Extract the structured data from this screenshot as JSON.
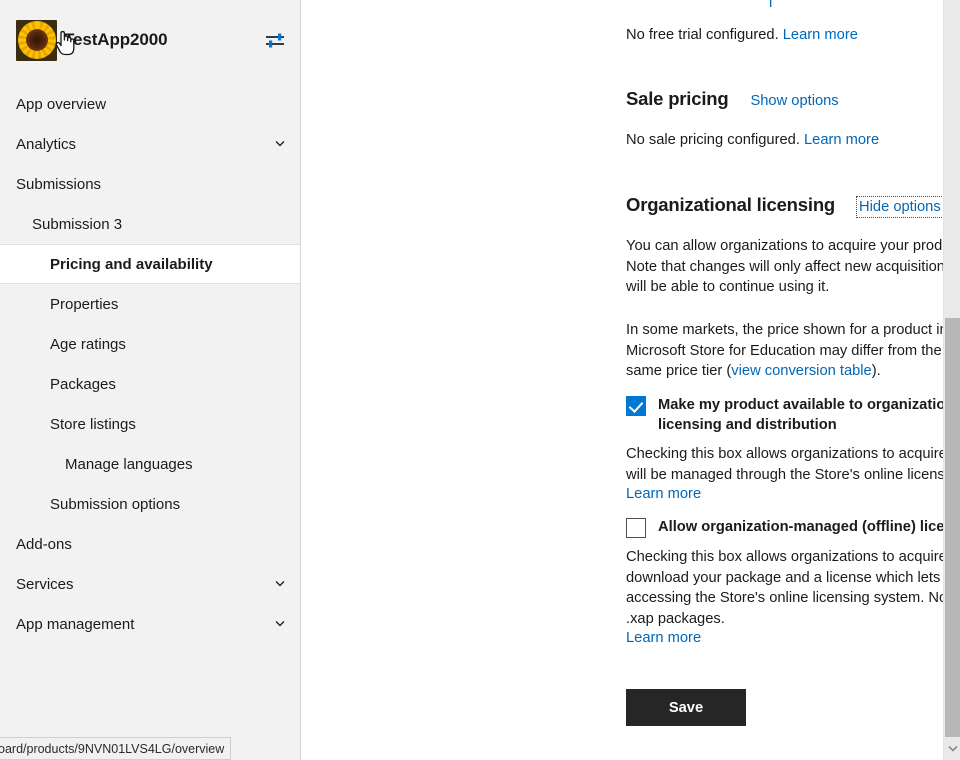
{
  "sidebar": {
    "brand": {
      "name": "TestApp2000",
      "logo_icon": "sunflower-app-icon",
      "toggle_icon": "sliders-settings-icon"
    },
    "items": [
      {
        "label": "App overview",
        "level": 0,
        "selected": false,
        "chevron": false
      },
      {
        "label": "Analytics",
        "level": 0,
        "selected": false,
        "chevron": true
      },
      {
        "label": "Submissions",
        "level": 0,
        "selected": false,
        "chevron": false
      },
      {
        "label": "Submission 3",
        "level": 1,
        "selected": false,
        "chevron": false
      },
      {
        "label": "Pricing and availability",
        "level": 2,
        "selected": true,
        "chevron": false
      },
      {
        "label": "Properties",
        "level": 2,
        "selected": false,
        "chevron": false
      },
      {
        "label": "Age ratings",
        "level": 2,
        "selected": false,
        "chevron": false
      },
      {
        "label": "Packages",
        "level": 2,
        "selected": false,
        "chevron": false
      },
      {
        "label": "Store listings",
        "level": 2,
        "selected": false,
        "chevron": false
      },
      {
        "label": "Manage languages",
        "level": 3,
        "selected": false,
        "chevron": false
      },
      {
        "label": "Submission options",
        "level": 2,
        "selected": false,
        "chevron": false
      },
      {
        "label": "Add-ons",
        "level": 0,
        "selected": false,
        "chevron": false
      },
      {
        "label": "Services",
        "level": 0,
        "selected": false,
        "chevron": true
      },
      {
        "label": "App management",
        "level": 0,
        "selected": false,
        "chevron": true
      }
    ]
  },
  "status_bar": {
    "url": "oard/products/9NVN01LVS4LG/overview"
  },
  "main": {
    "free_trial": {
      "text": "No free trial configured.",
      "link": "Learn more"
    },
    "sale_pricing": {
      "title": "Sale pricing",
      "toggle": "Show options",
      "text": "No sale pricing configured.",
      "link": "Learn more"
    },
    "org_licensing": {
      "title": "Organizational licensing",
      "toggle": "Hide options",
      "intro": "You can allow organizations to acquire your product in volume through the options below. Note that changes will only affect new acquisitions; anyone who already has your product will be able to continue using it.",
      "markets_pre": "In some markets, the price shown for a product in the Microsoft Store for Business and Microsoft Store for Education may differ from the price shown to retail customers for the same price tier (",
      "markets_link": "view conversion table",
      "markets_post": ").",
      "options": [
        {
          "checked": true,
          "label": "Make my product available to organizations with Store-managed (online) licensing and distribution",
          "description": "Checking this box allows organizations to acquire your product in volume. Product licenses will be managed through the Store's online licensing system.",
          "link": "Learn more"
        },
        {
          "checked": false,
          "label": "Allow organization-managed (offline) licensing and distribution for organizations",
          "description": "Checking this box allows organizations to acquire your product in volume. They can then download your package and a license which lets them install it to devices without accessing the Store's online licensing system. Note that this option is not supported for .xap packages.",
          "link": "Learn more"
        }
      ]
    },
    "save_label": "Save"
  },
  "colors": {
    "link": "#0067b8",
    "checkbox_accent": "#0078d4",
    "save_bg": "#262626",
    "sidebar_bg": "#f2f2f2"
  }
}
